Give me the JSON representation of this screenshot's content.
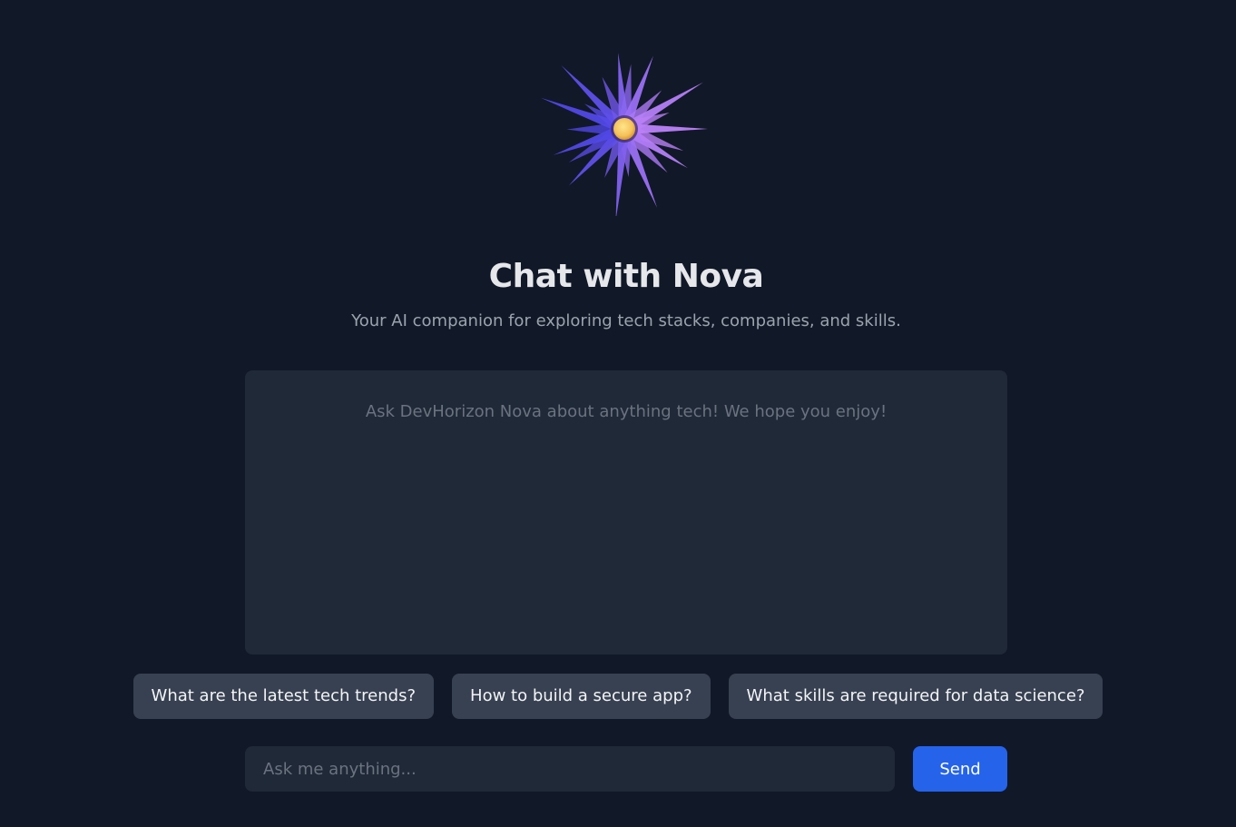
{
  "logo": {
    "icon": "starburst-logo-icon",
    "colors": {
      "rays_outer": "#4f46e5",
      "rays_inner": "#a855f7",
      "core": "#f5c15b"
    }
  },
  "header": {
    "title": "Chat with Nova",
    "subtitle": "Your AI companion for exploring tech stacks, companies, and skills."
  },
  "chat": {
    "empty_message": "Ask DevHorizon Nova about anything tech! We hope you enjoy!"
  },
  "suggestions": [
    {
      "label": "What are the latest tech trends?"
    },
    {
      "label": "How to build a secure app?"
    },
    {
      "label": "What skills are required for data science?"
    }
  ],
  "composer": {
    "placeholder": "Ask me anything...",
    "value": "",
    "send_label": "Send"
  },
  "colors": {
    "background": "#111827",
    "panel": "#1f2937",
    "chip": "#374151",
    "accent": "#2563eb"
  }
}
